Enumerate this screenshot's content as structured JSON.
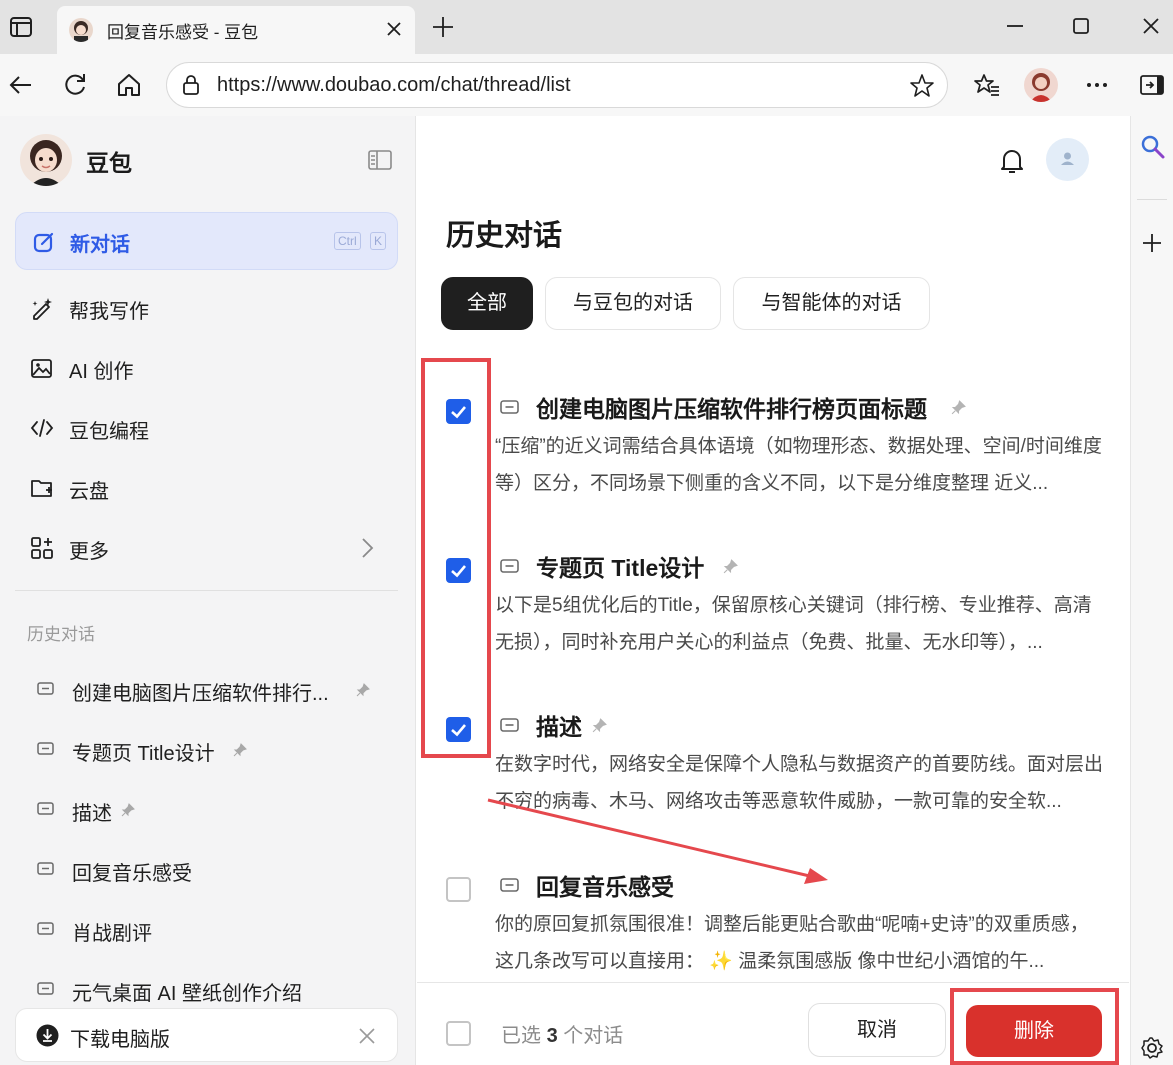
{
  "browser": {
    "tab_title": "回复音乐感受 - 豆包",
    "url": "https://www.doubao.com/chat/thread/list"
  },
  "sidebar": {
    "brand": "豆包",
    "new_chat": {
      "label": "新对话",
      "kbd1": "Ctrl",
      "kbd2": "K"
    },
    "menu": [
      {
        "label": "帮我写作",
        "icon": "pen-sparkle-icon"
      },
      {
        "label": "AI 创作",
        "icon": "image-sparkle-icon"
      },
      {
        "label": "豆包编程",
        "icon": "code-icon"
      },
      {
        "label": "云盘",
        "icon": "folder-icon"
      },
      {
        "label": "更多",
        "icon": "apps-icon"
      }
    ],
    "history_title": "历史对话",
    "history": [
      {
        "label": "创建电脑图片压缩软件排行...",
        "pinned": true
      },
      {
        "label": "专题页 Title设计",
        "pinned": true
      },
      {
        "label": "描述",
        "pinned": true
      },
      {
        "label": "回复音乐感受",
        "pinned": false
      },
      {
        "label": "肖战剧评",
        "pinned": false
      },
      {
        "label": "元气桌面 AI 壁纸创作介绍",
        "pinned": false
      }
    ],
    "download_label": "下载电脑版"
  },
  "main": {
    "title": "历史对话",
    "tabs": [
      "全部",
      "与豆包的对话",
      "与智能体的对话"
    ],
    "active_tab": "全部",
    "threads": [
      {
        "title": "创建电脑图片压缩软件排行榜页面标题",
        "pinned": true,
        "checked": true,
        "snippet": "“压缩”的近义词需结合具体语境（如物理形态、数据处理、空间/时间维度等）区分，不同场景下侧重的含义不同，以下是分维度整理 近义..."
      },
      {
        "title": "专题页 Title设计",
        "pinned": true,
        "checked": true,
        "snippet": "以下是5组优化后的Title，保留原核心关键词（排行榜、专业推荐、高清无损），同时补充用户关心的利益点（免费、批量、无水印等），..."
      },
      {
        "title": "描述",
        "pinned": true,
        "checked": true,
        "snippet": "在数字时代，网络安全是保障个人隐私与数据资产的首要防线。面对层出不穷的病毒、木马、网络攻击等恶意软件威胁，一款可靠的安全软..."
      },
      {
        "title": "回复音乐感受",
        "pinned": false,
        "checked": false,
        "snippet": "你的原回复抓氛围很准！调整后能更贴合歌曲“呢喃+史诗”的双重质感，这几条改写可以直接用： ✨ 温柔氛围感版 像中世纪小酒馆的午..."
      }
    ],
    "footer": {
      "selected_prefix": "已选",
      "selected_count": "3",
      "selected_suffix": "个对话",
      "cancel": "取消",
      "delete": "删除"
    }
  },
  "colors": {
    "accent": "#2f5be6",
    "checkbox": "#1f5ee8",
    "danger": "#d9312c",
    "annotation": "#e5484d"
  }
}
